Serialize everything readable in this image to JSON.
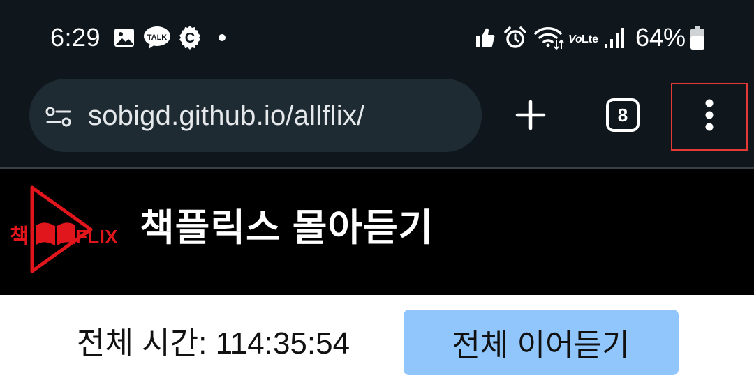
{
  "status_bar": {
    "time": "6:29",
    "battery_percent": "64%",
    "network_label": "Vo LTE",
    "tab_count_icon": "C",
    "notification_icons": [
      "gallery-icon",
      "kakaotalk-icon",
      "c-app-icon",
      "more-notifications-dot-icon"
    ],
    "system_icons": [
      "thumbs-up-icon",
      "alarm-icon",
      "wifi-icon",
      "volte-icon",
      "signal-icon",
      "battery-icon"
    ]
  },
  "kakao_label": "TALK",
  "browser": {
    "url": "sobigd.github.io/allflix/",
    "tab_count": "8",
    "icons": [
      "site-settings-icon",
      "new-tab-plus-icon",
      "tab-switcher-icon",
      "more-menu-icon"
    ],
    "highlight_color": "#e53935"
  },
  "page": {
    "logo_text_left": "책",
    "logo_text_right": "FLIX",
    "title": "책플릭스 몰아듣기",
    "total_time_label": "전체 시간: 114:35:54",
    "resume_all_button": "전체 이어듣기"
  },
  "colors": {
    "chrome_bg": "#0f171d",
    "url_bar_bg": "#1f2b33",
    "page_header_bg": "#000000",
    "logo_red": "#e0161c",
    "button_bg": "#90c6fb"
  }
}
